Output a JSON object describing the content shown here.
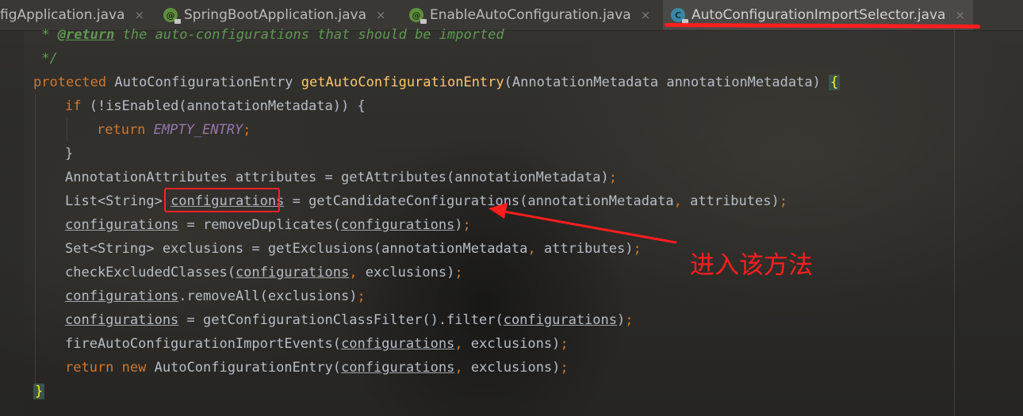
{
  "tabs": [
    {
      "label": "figApplication.java",
      "icon": "none",
      "active": false
    },
    {
      "label": "SpringBootApplication.java",
      "icon": "annotation-icon",
      "active": false
    },
    {
      "label": "EnableAutoConfiguration.java",
      "icon": "annotation-icon",
      "active": false
    },
    {
      "label": "AutoConfigurationImportSelector.java",
      "icon": "class-icon",
      "active": true
    }
  ],
  "tab_icon_glyphs": {
    "annotation": "@",
    "class": "C"
  },
  "close_glyph": "×",
  "code": {
    "l0_star": " * ",
    "l0_tag": "@return",
    "l0_text": " the auto-configurations that should be imported",
    "l1": " */",
    "l2_kw": "protected",
    "l2_type": " AutoConfigurationEntry ",
    "l2_fn": "getAutoConfigurationEntry",
    "l2_args": "(AnnotationMetadata annotationMetadata) ",
    "l2_brace": "{",
    "l3_kw": "if",
    "l3_rest": " (!isEnabled(annotationMetadata)) {",
    "l4_kw": "return",
    "l4_const": "EMPTY_ENTRY",
    "l4_end": ";",
    "l5": "}",
    "l6_a": "AnnotationAttributes attributes = getAttributes(annotationMetadata)",
    "l6_end": ";",
    "l7_a": "List<String> ",
    "l7_var": "configurations",
    "l7_b": " = getCandidateConfigurations(annotationMetadata",
    "l7_comma": ",",
    "l7_c": " attributes)",
    "l7_end": ";",
    "l8_var": "configurations",
    "l8_a": " = removeDuplicates(",
    "l8_var2": "configurations",
    "l8_b": ")",
    "l8_end": ";",
    "l9_a": "Set<String> exclusions = getExclusions(annotationMetadata",
    "l9_comma": ",",
    "l9_b": " attributes)",
    "l9_end": ";",
    "l10_a": "checkExcludedClasses(",
    "l10_var": "configurations",
    "l10_comma": ",",
    "l10_b": " exclusions)",
    "l10_end": ";",
    "l11_var": "configurations",
    "l11_a": ".removeAll(exclusions)",
    "l11_end": ";",
    "l12_var": "configurations",
    "l12_a": " = getConfigurationClassFilter().filter(",
    "l12_var2": "configurations",
    "l12_b": ")",
    "l12_end": ";",
    "l13_a": "fireAutoConfigurationImportEvents(",
    "l13_var": "configurations",
    "l13_comma": ",",
    "l13_b": " exclusions)",
    "l13_end": ";",
    "l14_kw": "return",
    "l14_kw2": "new",
    "l14_a": " AutoConfigurationEntry(",
    "l14_var": "configurations",
    "l14_comma": ",",
    "l14_b": " exclusions)",
    "l14_end": ";",
    "l15": "}"
  },
  "annotation_text": "进入该方法",
  "colors": {
    "keyword": "#cc7832",
    "function": "#ffc66d",
    "constant": "#9876aa",
    "comment": "#629755",
    "annotation_red": "#ff1e1e"
  }
}
